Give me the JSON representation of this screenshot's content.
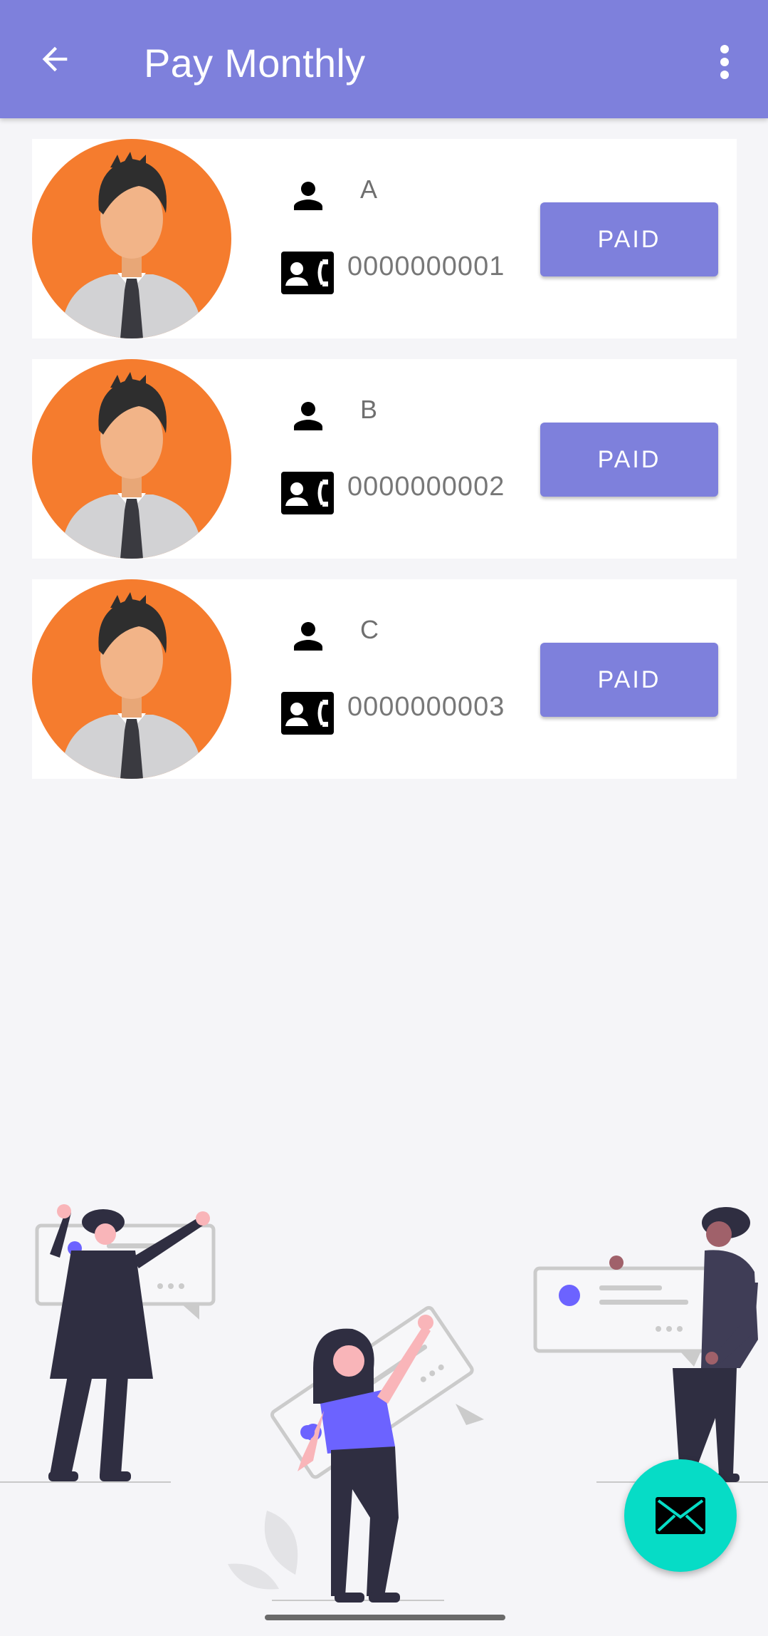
{
  "appbar": {
    "title": "Pay Monthly",
    "back_icon": "arrow-back-icon",
    "menu_icon": "more-vert-icon"
  },
  "customers": [
    {
      "name": "A",
      "phone": "0000000001",
      "status_label": "PAID"
    },
    {
      "name": "B",
      "phone": "0000000002",
      "status_label": "PAID"
    },
    {
      "name": "C",
      "phone": "0000000003",
      "status_label": "PAID"
    }
  ],
  "fab": {
    "icon": "mail-icon"
  },
  "colors": {
    "primary": "#7E80DC",
    "accent": "#06DCC6",
    "avatar_bg": "#F57C2E",
    "background": "#F5F5F8"
  }
}
